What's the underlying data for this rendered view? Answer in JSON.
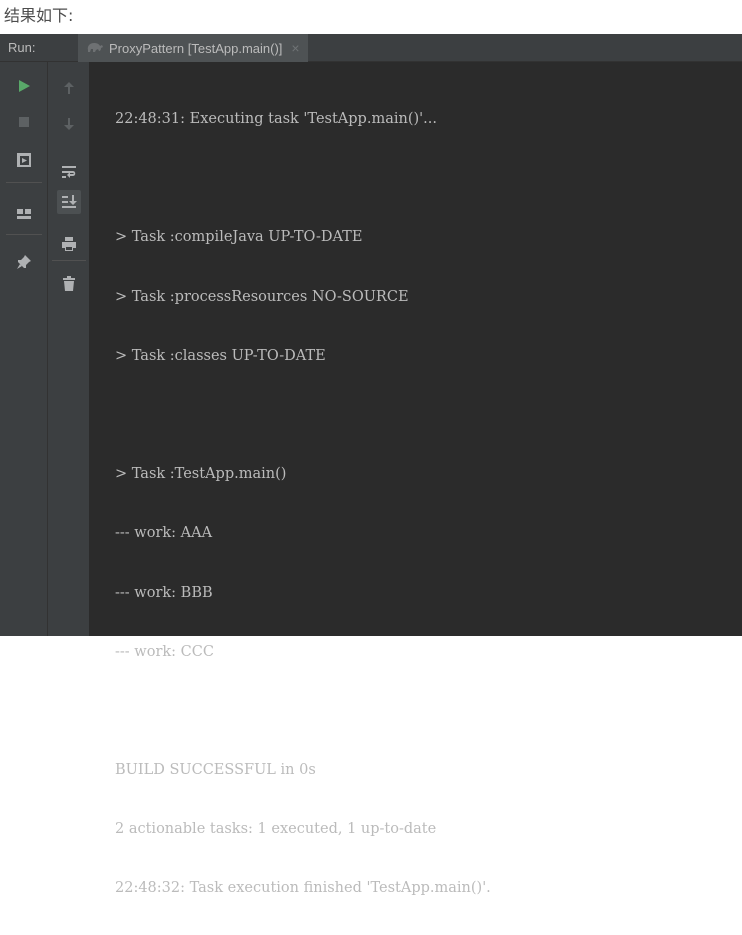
{
  "caption": "结果如下:",
  "tabbar": {
    "run_label": "Run:",
    "tab_title": "ProxyPattern [TestApp.main()]",
    "tab_icon": "gradle-elephant-icon",
    "close_glyph": "×"
  },
  "toolbar_left": [
    {
      "name": "rerun-icon",
      "color": "#59a869"
    },
    {
      "name": "stop-icon",
      "color": "#5d6163"
    },
    {
      "name": "restore-layout-icon",
      "color": "#afb1b3"
    },
    {
      "name": "layout-icon",
      "color": "#afb1b3"
    },
    {
      "name": "pin-tab-icon",
      "color": "#afb1b3"
    }
  ],
  "toolbar_right": [
    {
      "name": "up-arrow-icon",
      "color": "#5d6163"
    },
    {
      "name": "down-arrow-icon",
      "color": "#5d6163"
    },
    {
      "name": "soft-wrap-icon",
      "color": "#afb1b3"
    },
    {
      "name": "scroll-to-end-icon",
      "color": "#afb1b3"
    },
    {
      "name": "print-icon",
      "color": "#afb1b3"
    },
    {
      "name": "trash-icon",
      "color": "#afb1b3"
    }
  ],
  "console": {
    "lines": [
      "22:48:31: Executing task 'TestApp.main()'...",
      "",
      "> Task :compileJava UP-TO-DATE",
      "> Task :processResources NO-SOURCE",
      "> Task :classes UP-TO-DATE",
      "",
      "> Task :TestApp.main()",
      "--- work: AAA",
      "--- work: BBB",
      "--- work: CCC",
      "",
      "BUILD SUCCESSFUL in 0s",
      "2 actionable tasks: 1 executed, 1 up-to-date",
      "22:48:32: Task execution finished 'TestApp.main()'."
    ]
  }
}
